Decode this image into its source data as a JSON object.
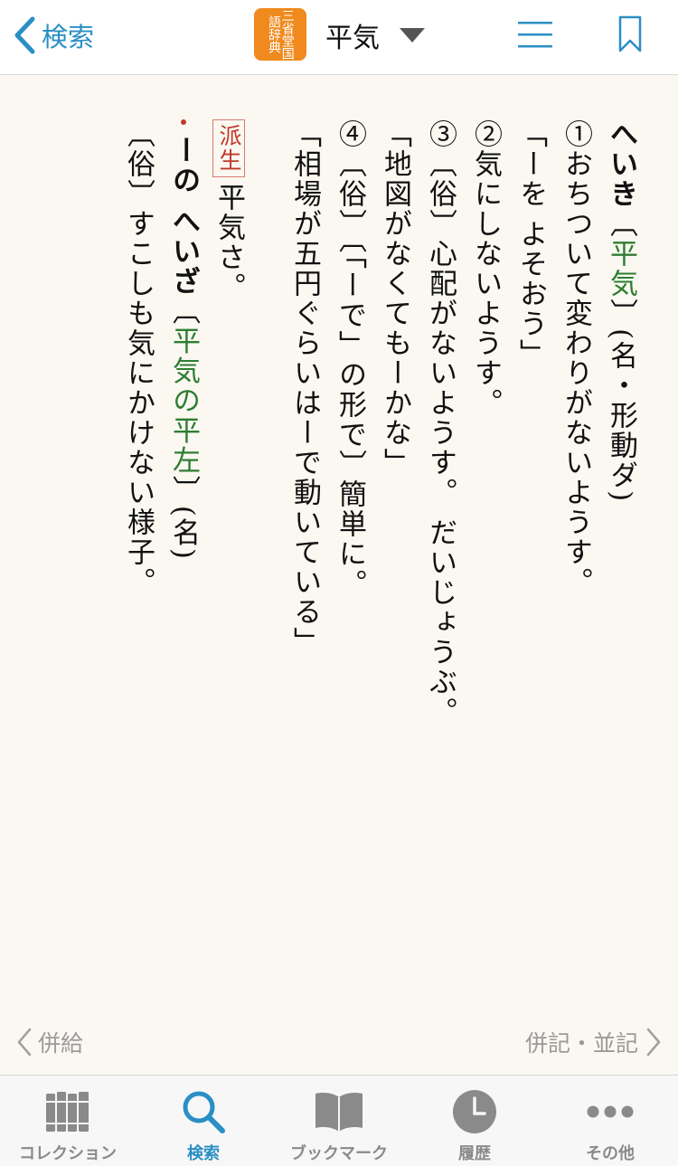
{
  "header": {
    "back_label": "検索",
    "logo_text": "三省堂国語辞典",
    "title": "平気"
  },
  "entry": {
    "headword": "へいき",
    "kanji": "平気",
    "pos": "(名・形動ダ)",
    "lines": [
      "①おちついて変わりがないようす。",
      "「ーを よそおう」",
      "②気にしないようす。",
      "③〔俗〕心配がないようす。 だいじょうぶ。",
      "「地図がなくてもーかな」",
      "④〔俗〕〔「ーで」の形で〕簡単に。",
      "「相場が五円ぐらいはーで動いている」"
    ],
    "derived_badge": "派生",
    "derived_text": "平気さ。",
    "sub_headword": "ーの へいざ",
    "sub_kanji": "平気の平左",
    "sub_pos": "(名)",
    "sub_def": "〔俗〕すこしも気にかけない様子。"
  },
  "nav": {
    "prev": "併給",
    "next": "併記・並記"
  },
  "tabs": [
    {
      "label": "コレクション",
      "icon": "books-icon",
      "active": false
    },
    {
      "label": "検索",
      "icon": "search-icon",
      "active": true
    },
    {
      "label": "ブックマーク",
      "icon": "open-book-icon",
      "active": false
    },
    {
      "label": "履歴",
      "icon": "clock-icon",
      "active": false
    },
    {
      "label": "その他",
      "icon": "more-dots-icon",
      "active": false
    }
  ],
  "colors": {
    "accent": "#2a8fc4",
    "logo": "#f08a1e",
    "kanji_green": "#2e7d32",
    "badge_red": "#c0392b",
    "background": "#faf8f1"
  }
}
